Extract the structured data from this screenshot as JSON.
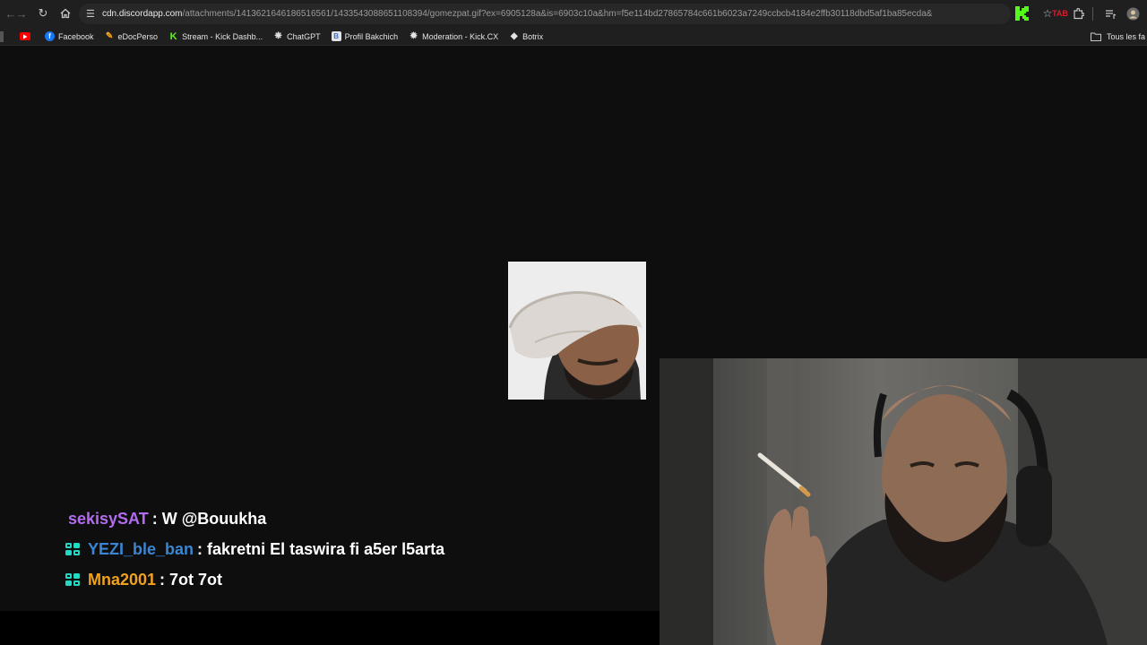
{
  "browser": {
    "url_host": "cdn.discordapp.com",
    "url_path": "/attachments/1413621646186516561/1433543088651108394/gomezpat.gif?ex=6905128a&is=6903c10a&hm=f5e114bd27865784c661b6023a7249ccbcb4184e2ffb30118dbd5af1ba85ecda&",
    "extension_badge": "TAB"
  },
  "bookmarks": [
    {
      "label": "",
      "icon": "youtube-icon",
      "color": "#ff0000"
    },
    {
      "label": "Facebook",
      "icon": "facebook-icon",
      "color": "#1877f2"
    },
    {
      "label": "eDocPerso",
      "icon": "edocperso-icon",
      "color": "#f4a51c"
    },
    {
      "label": "Stream - Kick Dashb...",
      "icon": "kick-icon",
      "color": "#53fc18"
    },
    {
      "label": "ChatGPT",
      "icon": "chatgpt-icon",
      "color": "#e3e3e3"
    },
    {
      "label": "Profil Bakchich",
      "icon": "bakchich-icon",
      "color": "#3b6fd8"
    },
    {
      "label": "Moderation - Kick.CX",
      "icon": "moderation-icon",
      "color": "#e3e3e3"
    },
    {
      "label": "Botrix",
      "icon": "botrix-icon",
      "color": "#e3e3e3"
    }
  ],
  "bookmarks_folder": "Tous les fa",
  "chat": [
    {
      "user": "sekisySAT",
      "user_color": "#b36cf0",
      "text": ": W @Bouukha",
      "badge": false
    },
    {
      "user": "YEZI_ble_ban",
      "user_color": "#3a86d4",
      "text": ": fakretni El taswira fi a5er l5arta",
      "badge": true
    },
    {
      "user": "Mna2001",
      "user_color": "#f0a21e",
      "text": ": 7ot 7ot",
      "badge": true
    }
  ]
}
